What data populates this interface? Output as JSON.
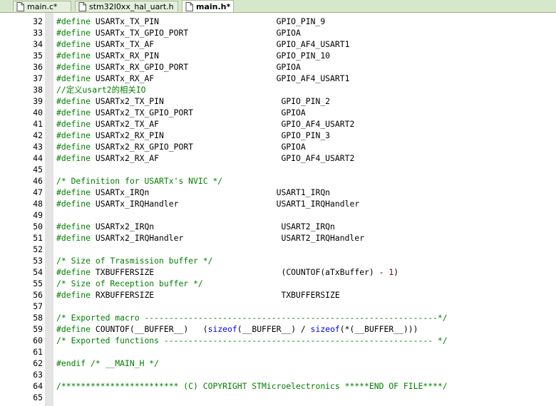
{
  "tabs": [
    {
      "label": "main.c*",
      "active": false
    },
    {
      "label": "stm32l0xx_hal_uart.h",
      "active": false
    },
    {
      "label": "main.h*",
      "active": true
    }
  ],
  "lines": [
    {
      "n": "32",
      "parts": [
        [
          "kw",
          "#define"
        ],
        [
          "t",
          " USARTx_TX_PIN                        GPIO_PIN_9"
        ]
      ]
    },
    {
      "n": "33",
      "parts": [
        [
          "kw",
          "#define"
        ],
        [
          "t",
          " USARTx_TX_GPIO_PORT                  GPIOA"
        ]
      ]
    },
    {
      "n": "34",
      "parts": [
        [
          "kw",
          "#define"
        ],
        [
          "t",
          " USARTx_TX_AF                         GPIO_AF4_USART1"
        ]
      ]
    },
    {
      "n": "35",
      "parts": [
        [
          "kw",
          "#define"
        ],
        [
          "t",
          " USARTx_RX_PIN                        GPIO_PIN_10"
        ]
      ]
    },
    {
      "n": "36",
      "parts": [
        [
          "kw",
          "#define"
        ],
        [
          "t",
          " USARTx_RX_GPIO_PORT                  GPIOA"
        ]
      ]
    },
    {
      "n": "37",
      "parts": [
        [
          "kw",
          "#define"
        ],
        [
          "t",
          " USARTx_RX_AF                         GPIO_AF4_USART1"
        ]
      ]
    },
    {
      "n": "38",
      "parts": [
        [
          "cm",
          "//定义usart2的相关IO"
        ]
      ]
    },
    {
      "n": "39",
      "parts": [
        [
          "kw",
          "#define"
        ],
        [
          "t",
          " USARTx2_TX_PIN                        GPIO_PIN_2"
        ]
      ]
    },
    {
      "n": "40",
      "parts": [
        [
          "kw",
          "#define"
        ],
        [
          "t",
          " USARTx2_TX_GPIO_PORT                  GPIOA"
        ]
      ]
    },
    {
      "n": "41",
      "parts": [
        [
          "kw",
          "#define"
        ],
        [
          "t",
          " USARTx2_TX_AF                         GPIO_AF4_USART2"
        ]
      ]
    },
    {
      "n": "42",
      "parts": [
        [
          "kw",
          "#define"
        ],
        [
          "t",
          " USARTx2_RX_PIN                        GPIO_PIN_3"
        ]
      ]
    },
    {
      "n": "43",
      "parts": [
        [
          "kw",
          "#define"
        ],
        [
          "t",
          " USARTx2_RX_GPIO_PORT                  GPIOA"
        ]
      ]
    },
    {
      "n": "44",
      "parts": [
        [
          "kw",
          "#define"
        ],
        [
          "t",
          " USARTx2_RX_AF                         GPIO_AF4_USART2"
        ]
      ]
    },
    {
      "n": "45",
      "parts": []
    },
    {
      "n": "46",
      "parts": [
        [
          "cm",
          "/* Definition for USARTx's NVIC */"
        ]
      ]
    },
    {
      "n": "47",
      "parts": [
        [
          "kw",
          "#define"
        ],
        [
          "t",
          " USARTx_IRQn                          USART1_IRQn"
        ]
      ]
    },
    {
      "n": "48",
      "parts": [
        [
          "kw",
          "#define"
        ],
        [
          "t",
          " USARTx_IRQHandler                    USART1_IRQHandler"
        ]
      ]
    },
    {
      "n": "49",
      "parts": []
    },
    {
      "n": "50",
      "parts": [
        [
          "kw",
          "#define"
        ],
        [
          "t",
          " USARTx2_IRQn                          USART2_IRQn"
        ]
      ]
    },
    {
      "n": "51",
      "parts": [
        [
          "kw",
          "#define"
        ],
        [
          "t",
          " USARTx2_IRQHandler                    USART2_IRQHandler"
        ]
      ]
    },
    {
      "n": "52",
      "parts": []
    },
    {
      "n": "53",
      "parts": [
        [
          "cm",
          "/* Size of Trasmission buffer */"
        ]
      ]
    },
    {
      "n": "54",
      "parts": [
        [
          "kw",
          "#define"
        ],
        [
          "t",
          " TXBUFFERSIZE                          (COUNTOF(aTxBuffer) - "
        ],
        [
          "num",
          "1"
        ],
        [
          "t",
          ")"
        ]
      ]
    },
    {
      "n": "55",
      "parts": [
        [
          "cm",
          "/* Size of Reception buffer */"
        ]
      ]
    },
    {
      "n": "56",
      "parts": [
        [
          "kw",
          "#define"
        ],
        [
          "t",
          " RXBUFFERSIZE                          TXBUFFERSIZE"
        ]
      ]
    },
    {
      "n": "57",
      "parts": []
    },
    {
      "n": "58",
      "parts": [
        [
          "cm",
          "/* Exported macro ------------------------------------------------------------*/"
        ]
      ]
    },
    {
      "n": "59",
      "parts": [
        [
          "kw",
          "#define"
        ],
        [
          "t",
          " COUNTOF(__BUFFER__)   ("
        ],
        [
          "sz",
          "sizeof"
        ],
        [
          "t",
          "(__BUFFER__) / "
        ],
        [
          "sz",
          "sizeof"
        ],
        [
          "t",
          "(*(__BUFFER__)))"
        ]
      ]
    },
    {
      "n": "60",
      "parts": [
        [
          "cm",
          "/* Exported functions ------------------------------------------------------- */"
        ]
      ]
    },
    {
      "n": "61",
      "parts": []
    },
    {
      "n": "62",
      "parts": [
        [
          "kw",
          "#endif"
        ],
        [
          "t",
          " "
        ],
        [
          "cm",
          "/* __MAIN_H */"
        ]
      ]
    },
    {
      "n": "63",
      "parts": []
    },
    {
      "n": "64",
      "parts": [
        [
          "cm",
          "/************************ (C) COPYRIGHT STMicroelectronics *****END OF FILE****/"
        ]
      ]
    },
    {
      "n": "65",
      "parts": []
    }
  ],
  "colors": {
    "keyword": "#008000",
    "comment": "#008000",
    "number": "#800000",
    "sizeof": "#0000ff",
    "tabbar": "#d7e7c9",
    "margin": "#e4e4e4"
  }
}
